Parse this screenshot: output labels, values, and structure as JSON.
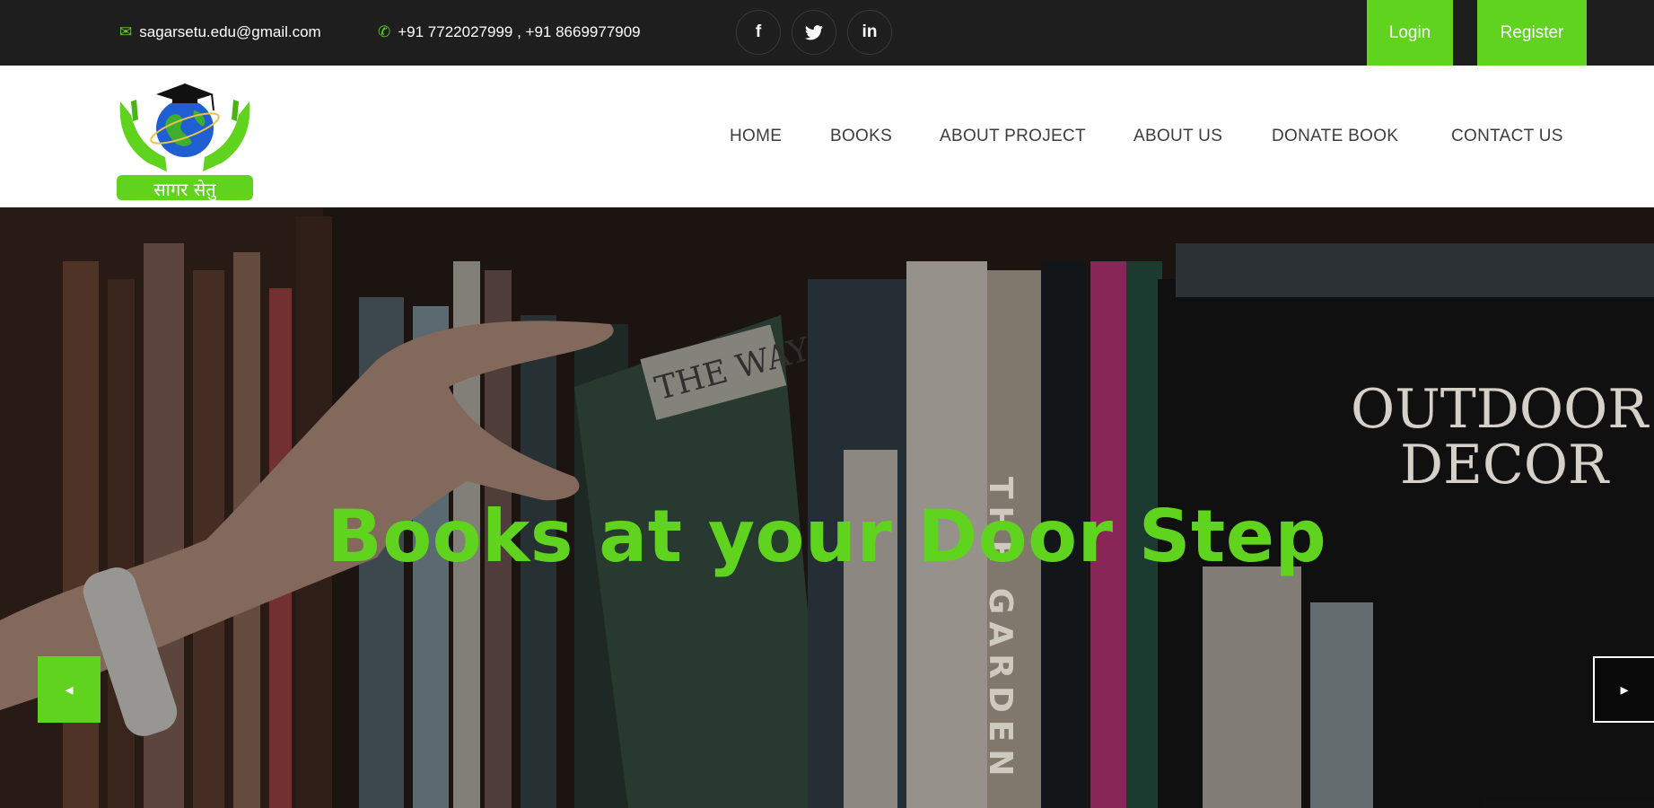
{
  "topbar": {
    "email": "sagarsetu.edu@gmail.com",
    "phone": "+91 7722027999 , +91 8669977909",
    "social": {
      "facebook": "f",
      "twitter": "t",
      "linkedin": "in"
    },
    "login_label": "Login",
    "register_label": "Register"
  },
  "logo": {
    "text": "सागर सेतु"
  },
  "nav": {
    "items": [
      {
        "label": "HOME"
      },
      {
        "label": "BOOKS"
      },
      {
        "label": "ABOUT PROJECT"
      },
      {
        "label": "ABOUT US"
      },
      {
        "label": "DONATE BOOK"
      },
      {
        "label": "CONTACT US"
      }
    ]
  },
  "hero": {
    "title": "Books at your Door Step",
    "book_spine_texts": [
      "THE WAY",
      "OUTDOOR",
      "DECOR",
      "THE GARDEN"
    ],
    "prev_icon": "chevron-left-icon",
    "next_icon": "chevron-right-icon"
  },
  "colors": {
    "accent": "#5fd31d",
    "topbar_bg": "#1e1e1e"
  }
}
